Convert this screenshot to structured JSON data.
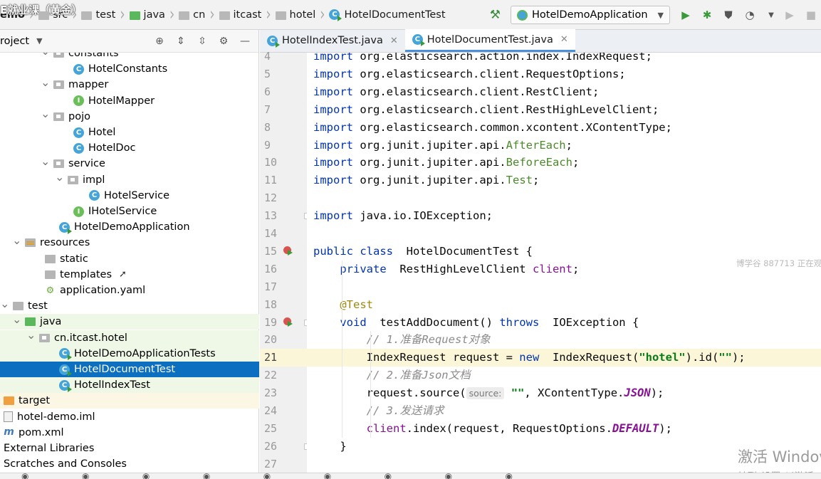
{
  "breadcrumb": {
    "items": [
      {
        "label": "emo",
        "overlay": "E就业课（黄金）"
      },
      {
        "label": "src"
      },
      {
        "label": "test"
      },
      {
        "label": "java"
      },
      {
        "label": "cn"
      },
      {
        "label": "itcast"
      },
      {
        "label": "hotel"
      },
      {
        "label": "HotelDocumentTest"
      }
    ]
  },
  "toolbar": {
    "run_config": "HotelDemoApplication"
  },
  "project_panel": {
    "title": "roject",
    "tree": [
      {
        "label": "constants",
        "icon": "package",
        "level": 4,
        "open": true
      },
      {
        "label": "HotelConstants",
        "icon": "class",
        "level": 5
      },
      {
        "label": "mapper",
        "icon": "package",
        "level": 4,
        "open": true
      },
      {
        "label": "HotelMapper",
        "icon": "interface",
        "level": 5
      },
      {
        "label": "pojo",
        "icon": "package",
        "level": 4,
        "open": true
      },
      {
        "label": "Hotel",
        "icon": "class",
        "level": 5
      },
      {
        "label": "HotelDoc",
        "icon": "class",
        "level": 5
      },
      {
        "label": "service",
        "icon": "package",
        "level": 4,
        "open": true
      },
      {
        "label": "impl",
        "icon": "package",
        "level": 5,
        "open": true
      },
      {
        "label": "HotelService",
        "icon": "class",
        "level": 6
      },
      {
        "label": "IHotelService",
        "icon": "interface",
        "level": 5
      },
      {
        "label": "HotelDemoApplication",
        "icon": "class-run",
        "level": 4
      },
      {
        "label": "resources",
        "icon": "resources",
        "level": 2,
        "open": true
      },
      {
        "label": "static",
        "icon": "folder",
        "level": 3
      },
      {
        "label": "templates",
        "icon": "folder",
        "level": 3
      },
      {
        "label": "application.yaml",
        "icon": "yaml",
        "level": 3
      },
      {
        "label": "test",
        "icon": "folder",
        "level": 1,
        "open": true
      },
      {
        "label": "java",
        "icon": "folder-green",
        "level": 2,
        "open": true,
        "style": "test"
      },
      {
        "label": "cn.itcast.hotel",
        "icon": "package",
        "level": 3,
        "open": true,
        "style": "test"
      },
      {
        "label": "HotelDemoApplicationTests",
        "icon": "class-run",
        "level": 4,
        "style": "test"
      },
      {
        "label": "HotelDocumentTest",
        "icon": "class-run",
        "level": 4,
        "style": "selected"
      },
      {
        "label": "HotelIndexTest",
        "icon": "class-run",
        "level": 4,
        "style": "test"
      },
      {
        "label": "target",
        "icon": "folder-orange",
        "level": 0,
        "style": "target"
      },
      {
        "label": "hotel-demo.iml",
        "icon": "file",
        "level": 0
      },
      {
        "label": "pom.xml",
        "icon": "maven",
        "level": 0
      },
      {
        "label": "External Libraries",
        "icon": "library",
        "level": 0
      },
      {
        "label": "Scratches and Consoles",
        "icon": "scratches",
        "level": 0
      }
    ]
  },
  "editor": {
    "tabs": [
      {
        "label": "HotelIndexTest.java",
        "active": false
      },
      {
        "label": "HotelDocumentTest.java",
        "active": true
      }
    ],
    "lines": [
      {
        "n": "4",
        "tokens": [
          [
            "kw",
            "import"
          ],
          [
            "",
            "org.elasticsearch.action.index.IndexRequest;"
          ]
        ]
      },
      {
        "n": "5",
        "tokens": [
          [
            "kw",
            "import"
          ],
          [
            "",
            "org.elasticsearch.client.RequestOptions;"
          ]
        ]
      },
      {
        "n": "6",
        "tokens": [
          [
            "kw",
            "import"
          ],
          [
            "",
            "org.elasticsearch.client.RestClient;"
          ]
        ]
      },
      {
        "n": "7",
        "tokens": [
          [
            "kw",
            "import"
          ],
          [
            "",
            "org.elasticsearch.client.RestHighLevelClient;"
          ]
        ]
      },
      {
        "n": "8",
        "tokens": [
          [
            "kw",
            "import"
          ],
          [
            "",
            "org.elasticsearch.common.xcontent.XContentType;"
          ]
        ]
      },
      {
        "n": "9",
        "tokens": [
          [
            "kw",
            "import"
          ],
          [
            "",
            "org.junit.jupiter.api."
          ],
          [
            "grn",
            "AfterEach"
          ],
          [
            "",
            ";"
          ]
        ]
      },
      {
        "n": "10",
        "tokens": [
          [
            "kw",
            "import"
          ],
          [
            "",
            "org.junit.jupiter.api."
          ],
          [
            "grn",
            "BeforeEach"
          ],
          [
            "",
            ";"
          ]
        ]
      },
      {
        "n": "11",
        "tokens": [
          [
            "kw",
            "import"
          ],
          [
            "",
            "org.junit.jupiter.api."
          ],
          [
            "grn",
            "Test"
          ],
          [
            "",
            ";"
          ]
        ]
      },
      {
        "n": "12",
        "tokens": []
      },
      {
        "n": "13",
        "tokens": [
          [
            "kw",
            "import"
          ],
          [
            "",
            "java.io.IOException;"
          ]
        ],
        "fold": true
      },
      {
        "n": "14",
        "tokens": []
      },
      {
        "n": "15",
        "tokens": [
          [
            "kw",
            "public class"
          ],
          [
            "",
            " HotelDocumentTest {"
          ]
        ],
        "run": true
      },
      {
        "n": "16",
        "tokens": [
          [
            "",
            "    "
          ],
          [
            "kw",
            "private"
          ],
          [
            "",
            " RestHighLevelClient "
          ],
          [
            "fld",
            "client"
          ],
          [
            "",
            ";"
          ]
        ]
      },
      {
        "n": "17",
        "tokens": []
      },
      {
        "n": "18",
        "tokens": [
          [
            "",
            "    "
          ],
          [
            "ann",
            "@Test"
          ]
        ]
      },
      {
        "n": "19",
        "tokens": [
          [
            "",
            "    "
          ],
          [
            "kw",
            "void"
          ],
          [
            "",
            " testAddDocument() "
          ],
          [
            "kw",
            "throws"
          ],
          [
            "",
            " IOException {"
          ]
        ],
        "run": true,
        "fold": true
      },
      {
        "n": "20",
        "tokens": [
          [
            "",
            "        "
          ],
          [
            "cmt",
            "// 1.准备Request对象"
          ]
        ]
      },
      {
        "n": "21",
        "tokens": [
          [
            "",
            "        IndexRequest request = "
          ],
          [
            "kw",
            "new"
          ],
          [
            "",
            " IndexRequest("
          ],
          [
            "str",
            "\"hotel\""
          ],
          [
            "",
            ").id("
          ],
          [
            "str",
            "\"\""
          ],
          [
            "",
            ");"
          ]
        ],
        "current": true
      },
      {
        "n": "22",
        "tokens": [
          [
            "",
            "        "
          ],
          [
            "cmt",
            "// 2.准备Json文档"
          ]
        ]
      },
      {
        "n": "23",
        "tokens": [
          [
            "",
            "        request.source("
          ],
          [
            "hint",
            "source:"
          ],
          [
            "",
            " "
          ],
          [
            "str",
            "\"\""
          ],
          [
            "",
            ", XContentType."
          ],
          [
            "cst",
            "JSON"
          ],
          [
            "",
            ");"
          ]
        ]
      },
      {
        "n": "24",
        "tokens": [
          [
            "",
            "        "
          ],
          [
            "cmt",
            "// 3.发送请求"
          ]
        ]
      },
      {
        "n": "25",
        "tokens": [
          [
            "",
            "        "
          ],
          [
            "fld",
            "client"
          ],
          [
            "",
            ".index(request, RequestOptions."
          ],
          [
            "cst",
            "DEFAULT"
          ],
          [
            "",
            ");"
          ]
        ]
      },
      {
        "n": "26",
        "tokens": [
          [
            "",
            "    }"
          ]
        ],
        "fold": true
      },
      {
        "n": "27",
        "tokens": []
      }
    ]
  },
  "overlays": {
    "watermark": "博学谷 887713 正在观",
    "activate_title": "激活 Windov",
    "activate_sub": "转到\"设置\"以激活"
  }
}
